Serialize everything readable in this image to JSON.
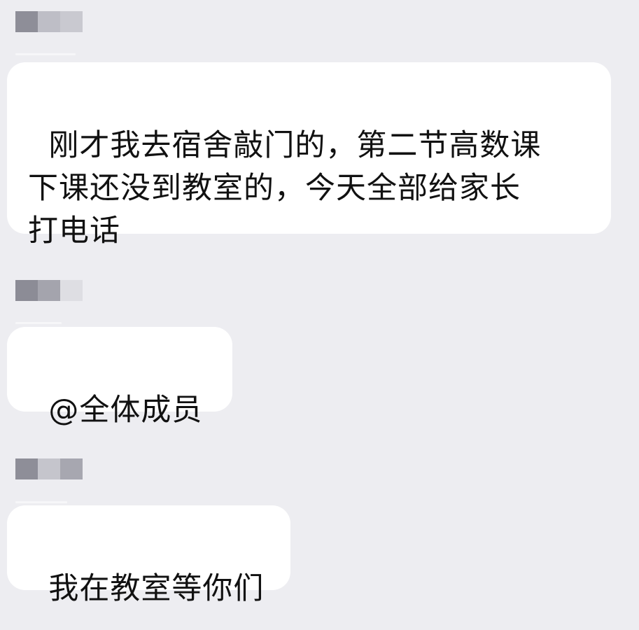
{
  "messages": [
    {
      "text": "刚才我去宿舍敲门的，第二节高数课\n下课还没到教室的，今天全部给家长\n打电话",
      "sender_colors": [
        "#8E8E98",
        "#BEBEC6",
        "#C9C9D0"
      ]
    },
    {
      "text": "@全体成员",
      "sender_colors": [
        "#8C8C96",
        "#A4A4AD",
        "#DEDEE3"
      ]
    },
    {
      "text": "我在教室等你们",
      "sender_colors": [
        "#8E8E98",
        "#C5C5CC",
        "#A7A7B0"
      ]
    }
  ]
}
